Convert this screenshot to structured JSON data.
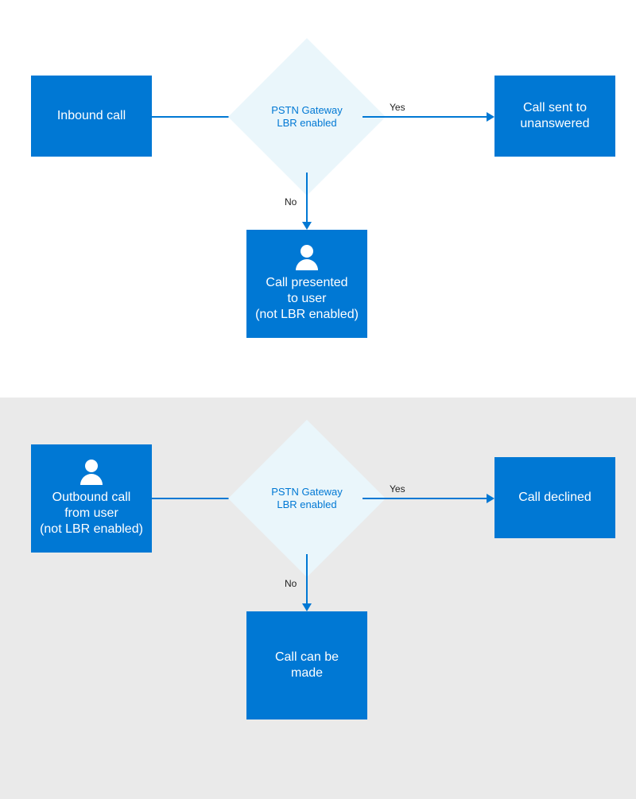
{
  "colors": {
    "primary": "#0078d4",
    "diamond_fill": "#eaf6fb",
    "panel_top_bg": "#ffffff",
    "panel_bottom_bg": "#eaeaea"
  },
  "flow_top": {
    "start": {
      "line1": "Inbound call"
    },
    "decision": {
      "line1": "PSTN Gateway",
      "line2": "LBR enabled"
    },
    "edge_yes": "Yes",
    "edge_no": "No",
    "result_yes": {
      "line1": "Call sent to",
      "line2": "unanswered"
    },
    "result_no": {
      "line1": "Call presented",
      "line2": "to user",
      "line3": "(not LBR enabled)"
    }
  },
  "flow_bottom": {
    "start": {
      "line1": "Outbound call",
      "line2": "from user",
      "line3": "(not LBR enabled)"
    },
    "decision": {
      "line1": "PSTN Gateway",
      "line2": "LBR enabled"
    },
    "edge_yes": "Yes",
    "edge_no": "No",
    "result_yes": {
      "line1": "Call declined"
    },
    "result_no": {
      "line1": "Call can be",
      "line2": "made"
    }
  }
}
